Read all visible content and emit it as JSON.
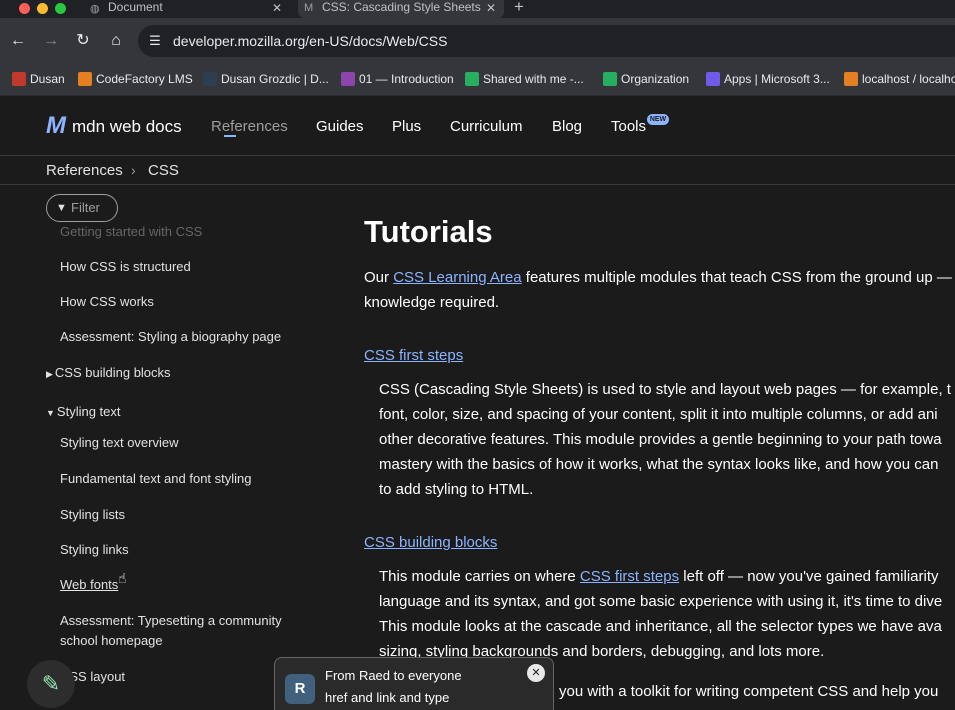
{
  "browser": {
    "tabs": [
      {
        "title": "Document",
        "close": "✕"
      },
      {
        "title": "CSS: Cascading Style Sheets",
        "close": "✕"
      }
    ],
    "new_tab": "+",
    "url": "developer.mozilla.org/en-US/docs/Web/CSS",
    "bookmarks": [
      {
        "label": "Dusan",
        "icon_color": "#c0392b"
      },
      {
        "label": "CodeFactory LMS",
        "icon_color": "#e67e22"
      },
      {
        "label": "Dusan Grozdic | D...",
        "icon_color": "#2c3e50"
      },
      {
        "label": "01 — Introduction",
        "icon_color": "#8e44ad"
      },
      {
        "label": "Shared with me -...",
        "icon_color": "#27ae60"
      },
      {
        "label": "Organization",
        "icon_color": "#27ae60"
      },
      {
        "label": "Apps | Microsoft 3...",
        "icon_color": "#6c5ce7"
      },
      {
        "label": "localhost / localho",
        "icon_color": "#e67e22"
      }
    ]
  },
  "header": {
    "logo_text": "mdn web docs",
    "nav": [
      "References",
      "Guides",
      "Plus",
      "Curriculum",
      "Blog",
      "Tools"
    ],
    "tools_badge": "NEW"
  },
  "breadcrumb": [
    "References",
    "CSS"
  ],
  "sidebar": {
    "filter_label": "Filter",
    "items": [
      "Getting started with CSS",
      "How CSS is structured",
      "How CSS works",
      "Assessment: Styling a biography page",
      "CSS building blocks",
      "Styling text",
      "Styling text overview",
      "Fundamental text and font styling",
      "Styling lists",
      "Styling links",
      "Web fonts",
      "Assessment: Typesetting a community",
      "school homepage",
      "CSS layout"
    ]
  },
  "main": {
    "title": "Tutorials",
    "intro": {
      "before": "Our ",
      "link": "CSS Learning Area",
      "after": " features multiple modules that teach CSS from the ground up —",
      "line2": "knowledge required."
    },
    "sections": [
      {
        "title": "CSS first steps",
        "lines": [
          "CSS (Cascading Style Sheets) is used to style and layout web pages — for example, t",
          "font, color, size, and spacing of your content, split it into multiple columns, or add ani",
          "other decorative features. This module provides a gentle beginning to your path towa",
          "mastery with the basics of how it works, what the syntax looks like, and how you can",
          "to add styling to HTML."
        ]
      },
      {
        "title": "CSS building blocks",
        "line1_before": "This module carries on where ",
        "line1_link": "CSS first steps",
        "line1_after": " left off — now you've gained familiarity",
        "lines": [
          "language and its syntax, and got some basic experience with using it, it's time to dive",
          "This module looks at the cascade and inheritance, all the selector types we have ava",
          "sizing, styling backgrounds and borders, debugging, and lots more."
        ]
      }
    ],
    "partial_line": "you with a toolkit for writing competent CSS and help you"
  },
  "toast": {
    "avatar_letter": "R",
    "from": "From Raed to everyone",
    "message": "href and link and type"
  }
}
